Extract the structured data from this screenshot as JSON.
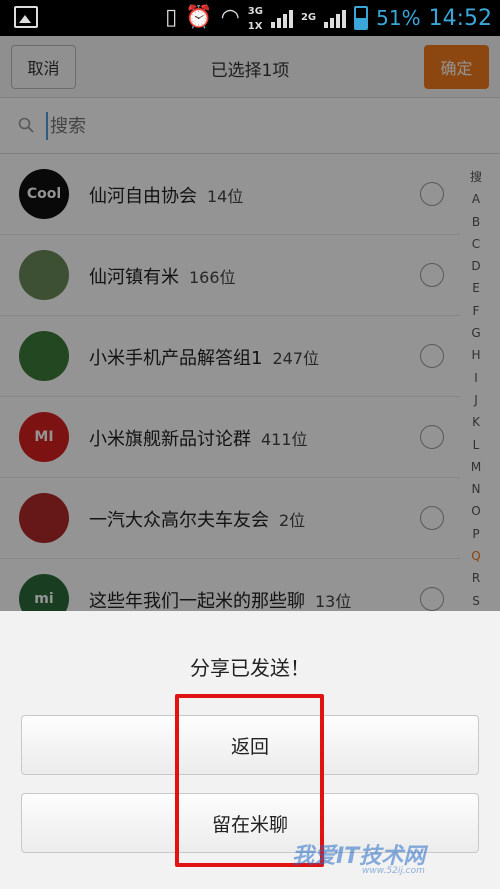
{
  "status_bar": {
    "network_top": "3G",
    "network_bottom": "1X",
    "network_2": "2G",
    "battery": "51%",
    "time": "14:52"
  },
  "header": {
    "cancel_label": "取消",
    "title": "已选择1项",
    "confirm_label": "确定"
  },
  "search": {
    "placeholder": "搜索"
  },
  "list": [
    {
      "name": "仙河自由协会",
      "count": "14位",
      "avatar_color": "#111111",
      "avatar_text": "Cool"
    },
    {
      "name": "仙河镇有米",
      "count": "166位",
      "avatar_color": "#6a8a5a",
      "avatar_text": ""
    },
    {
      "name": "小米手机产品解答组1",
      "count": "247位",
      "avatar_color": "#3c7a3a",
      "avatar_text": ""
    },
    {
      "name": "小米旗舰新品讨论群",
      "count": "411位",
      "avatar_color": "#d82020",
      "avatar_text": "MI"
    },
    {
      "name": "一汽大众高尔夫车友会",
      "count": "2位",
      "avatar_color": "#b02828",
      "avatar_text": ""
    },
    {
      "name": "这些年我们一起米的那些聊",
      "count": "13位",
      "avatar_color": "#2a6a3a",
      "avatar_text": "mi"
    }
  ],
  "index_bar": [
    "搜",
    "A",
    "B",
    "C",
    "D",
    "E",
    "F",
    "G",
    "H",
    "I",
    "J",
    "K",
    "L",
    "M",
    "N",
    "O",
    "P",
    "Q",
    "R",
    "S"
  ],
  "index_active": "Q",
  "dialog": {
    "title": "分享已发送！",
    "back_label": "返回",
    "stay_label": "留在米聊"
  },
  "watermark": {
    "main": "我爱IT技术网",
    "sub": "www.52ij.com"
  },
  "colors": {
    "accent": "#f07b1b",
    "highlight": "#e01212",
    "status_blue": "#3aa7d8"
  }
}
